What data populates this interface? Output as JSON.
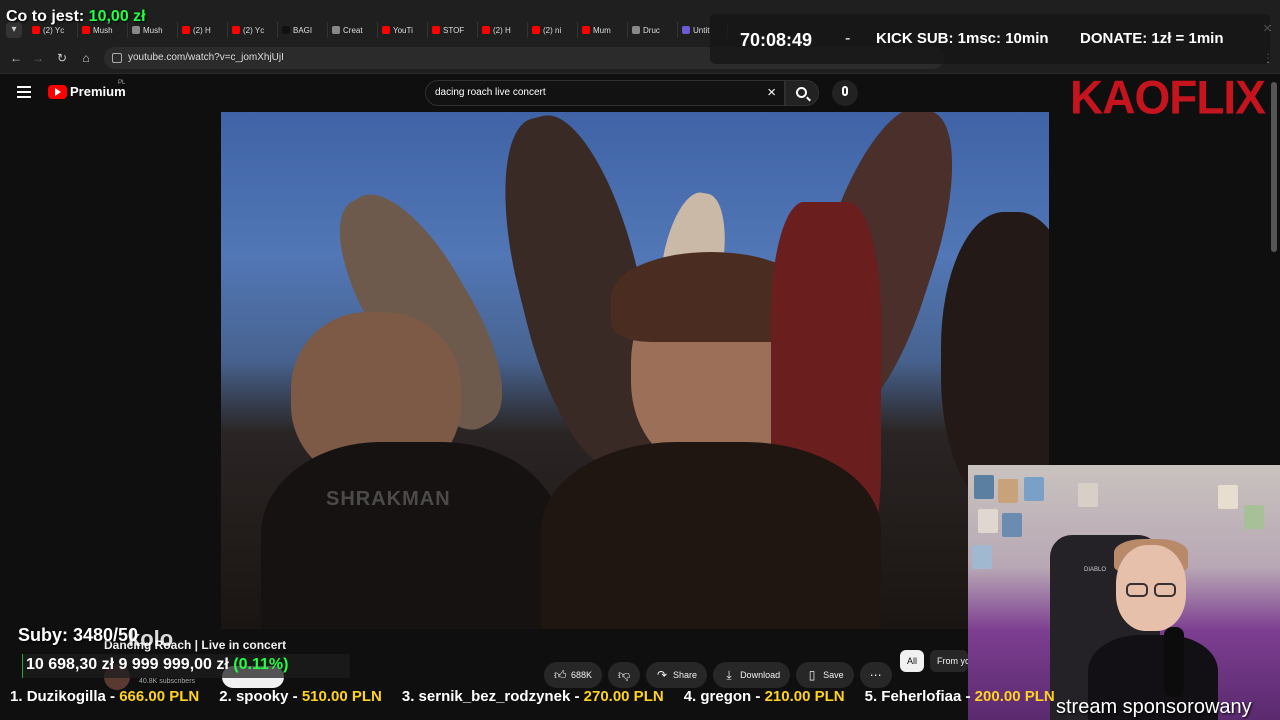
{
  "overlay": {
    "donate_label": "Co to jest:",
    "donate_value": "10,00 zł",
    "timer": "70:08:49",
    "timer_sep": "-",
    "kick_sub": "KICK SUB: 1msc: 10min",
    "donate_rate": "DONATE: 1zł = 1min",
    "brand": "KAOFLIX",
    "subs": "Suby: 3480/50",
    "ghost_text": "kolo",
    "goal_current": "10 698,30 zł",
    "goal_target": " 9 999 999,00 zł",
    "goal_percent": " (0.11%)",
    "goal_fraction": 0.0011,
    "webcam_caption": "stream sponsorowany",
    "chair_brand": "DIABLO",
    "ticker": [
      {
        "rank": "1.",
        "name": "Duzikogilla",
        "amount": "666.00 PLN"
      },
      {
        "rank": "2.",
        "name": "spooky",
        "amount": "510.00 PLN"
      },
      {
        "rank": "3.",
        "name": "sernik_bez_rodzynek",
        "amount": "270.00 PLN"
      },
      {
        "rank": "4.",
        "name": "gregon",
        "amount": "210.00 PLN"
      },
      {
        "rank": "5.",
        "name": "Feherlofiaa",
        "amount": "200.00 PLN"
      }
    ]
  },
  "browser": {
    "tabs": [
      {
        "label": "(2) Yc",
        "color": "#ff0000"
      },
      {
        "label": "Mush",
        "color": "#ff0000"
      },
      {
        "label": "Mush",
        "color": "#888888"
      },
      {
        "label": "(2) H",
        "color": "#ff0000"
      },
      {
        "label": "(2) Yc",
        "color": "#ff0000"
      },
      {
        "label": "BAGI",
        "color": "#111111"
      },
      {
        "label": "Creat",
        "color": "#888888"
      },
      {
        "label": "YouTi",
        "color": "#ff0000"
      },
      {
        "label": "STOF",
        "color": "#ff0000"
      },
      {
        "label": "(2) H",
        "color": "#ff0000"
      },
      {
        "label": "(2) ni",
        "color": "#ff0000"
      },
      {
        "label": "Mum",
        "color": "#ff0000"
      },
      {
        "label": "Druc",
        "color": "#888888"
      },
      {
        "label": "Untit",
        "color": "#6b5bd6"
      }
    ],
    "url": "youtube.com/watch?v=c_jomXhjUjI"
  },
  "youtube": {
    "brand": "Premium",
    "country": "PL",
    "search_query": "dacing roach live concert",
    "video_title": "Dancing Roach | Live in concert",
    "watermark": "SHRAKMAN",
    "subscriber_count": "40.8K subscribers",
    "likes": "688K",
    "share_label": "Share",
    "download_label": "Download",
    "save_label": "Save",
    "chip_all": "All",
    "chip_from": "From yo"
  },
  "colors": {
    "accent_red": "#ff0000",
    "goal_green": "#22ff44",
    "ticker_gold": "#ffd21f",
    "brand_red": "#c6141f"
  }
}
